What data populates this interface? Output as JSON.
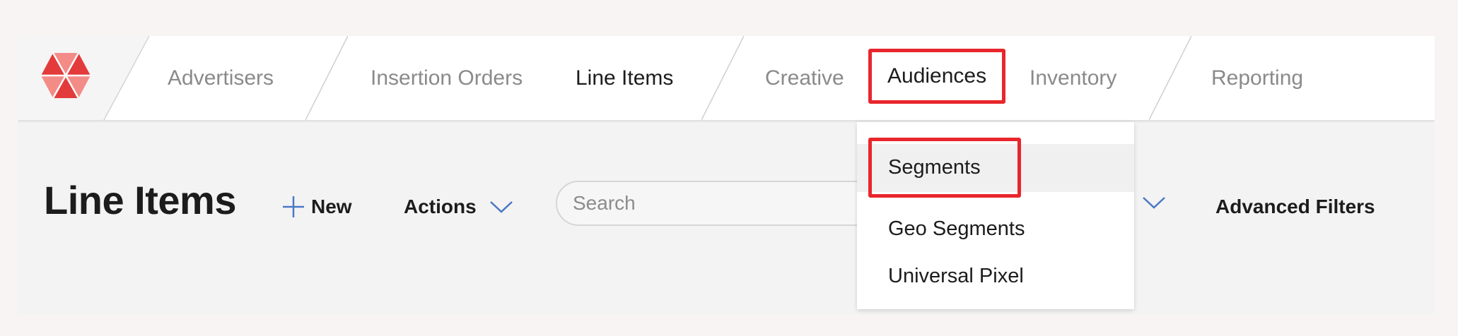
{
  "colors": {
    "accent_red": "#e8262c",
    "logo_dark": "#e33b3b",
    "logo_light": "#f38b87",
    "chevron_blue": "#4a78c4"
  },
  "nav": {
    "logo_icon": "hexagon-logo",
    "items": [
      {
        "label": "Advertisers"
      },
      {
        "label": "Insertion Orders"
      },
      {
        "label": "Line Items"
      },
      {
        "label": "Creative"
      },
      {
        "label": "Audiences"
      },
      {
        "label": "Inventory"
      },
      {
        "label": "Reporting"
      }
    ]
  },
  "page": {
    "title": "Line Items",
    "new_label": "New",
    "actions_label": "Actions",
    "search_placeholder": "Search",
    "advanced_filters_label": "Advanced Filters"
  },
  "dropdown": {
    "items": [
      {
        "label": "Segments"
      },
      {
        "label": "Geo Segments"
      },
      {
        "label": "Universal Pixel"
      }
    ]
  }
}
